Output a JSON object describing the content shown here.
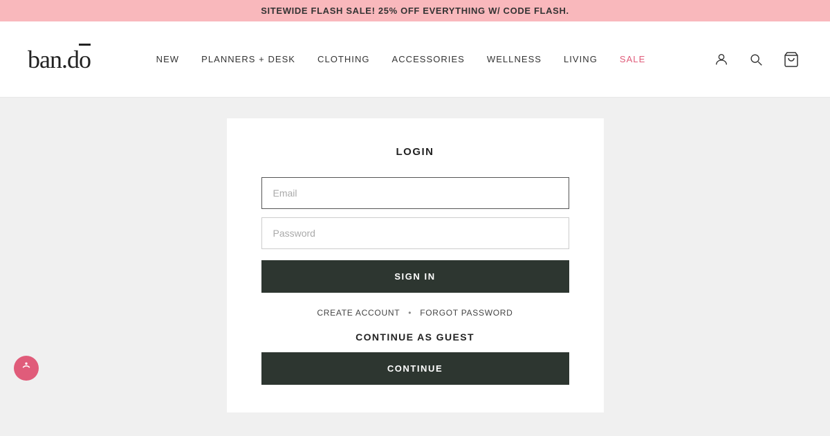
{
  "announcement": {
    "text": "SITEWIDE FLASH SALE! 25% OFF EVERYTHING W/ CODE FLASH."
  },
  "header": {
    "logo": "ban.dō",
    "nav_items": [
      {
        "label": "NEW",
        "id": "new"
      },
      {
        "label": "PLANNERS + DESK",
        "id": "planners-desk"
      },
      {
        "label": "CLOTHING",
        "id": "clothing"
      },
      {
        "label": "ACCESSORIES",
        "id": "accessories"
      },
      {
        "label": "WELLNESS",
        "id": "wellness"
      },
      {
        "label": "LIVING",
        "id": "living"
      },
      {
        "label": "SALE",
        "id": "sale",
        "highlight": true
      }
    ]
  },
  "login_form": {
    "title": "LOGIN",
    "email_placeholder": "Email",
    "password_placeholder": "Password",
    "sign_in_label": "SIGN IN",
    "create_account_label": "CREATE ACCOUNT",
    "forgot_password_label": "FORGOT PASSWORD",
    "guest_title": "CONTINUE AS GUEST",
    "continue_label": "CONTINUE"
  }
}
